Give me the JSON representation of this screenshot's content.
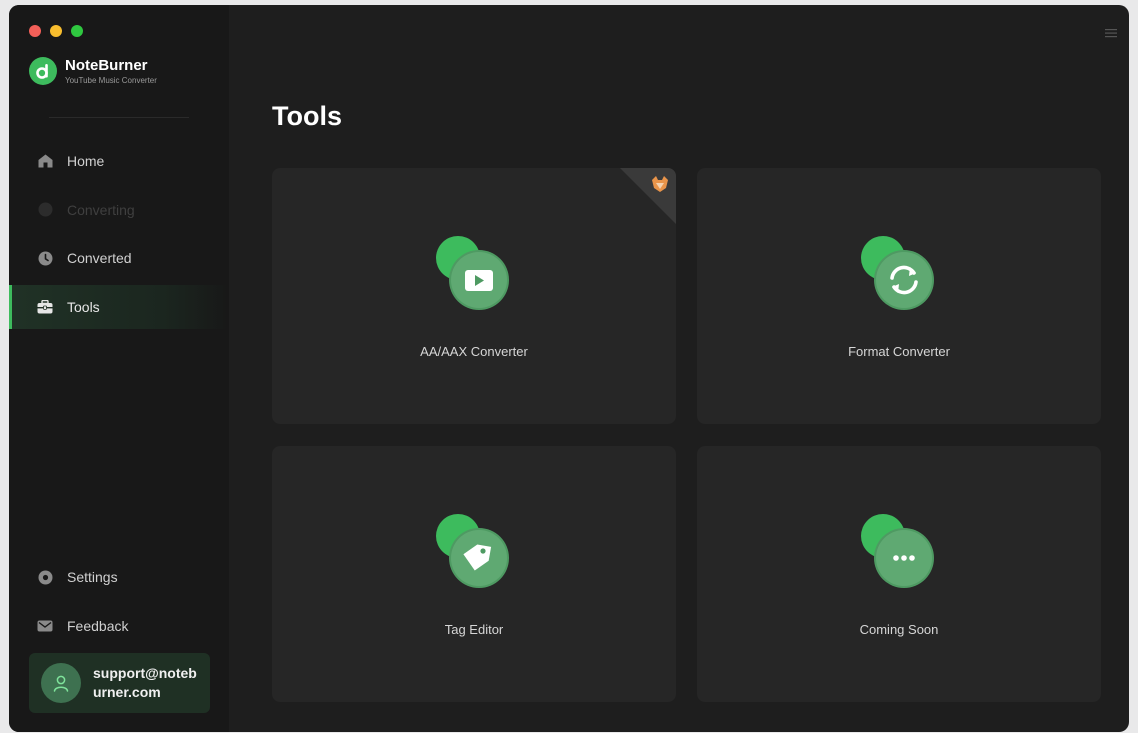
{
  "app": {
    "name": "NoteBurner",
    "subtitle": "YouTube Music Converter"
  },
  "sidebar": {
    "items": [
      {
        "label": "Home",
        "state": "normal",
        "icon": "home-icon"
      },
      {
        "label": "Converting",
        "state": "disabled",
        "icon": "converting-icon"
      },
      {
        "label": "Converted",
        "state": "normal",
        "icon": "clock-icon"
      },
      {
        "label": "Tools",
        "state": "active",
        "icon": "toolbox-icon"
      }
    ],
    "bottom_items": [
      {
        "label": "Settings",
        "icon": "gear-icon"
      },
      {
        "label": "Feedback",
        "icon": "mail-icon"
      }
    ]
  },
  "account": {
    "email": "support@noteburner.com"
  },
  "main": {
    "title": "Tools",
    "tools": [
      {
        "label": "AA/AAX Converter",
        "icon": "audiobook-play-icon",
        "badge": "fox-pro-icon"
      },
      {
        "label": "Format Converter",
        "icon": "refresh-icon"
      },
      {
        "label": "Tag Editor",
        "icon": "tag-icon"
      },
      {
        "label": "Coming Soon",
        "icon": "more-icon"
      }
    ]
  },
  "colors": {
    "accent": "#3dbb5d",
    "background": "#1e1e1e",
    "sidebar": "#181818",
    "card": "#262626"
  }
}
